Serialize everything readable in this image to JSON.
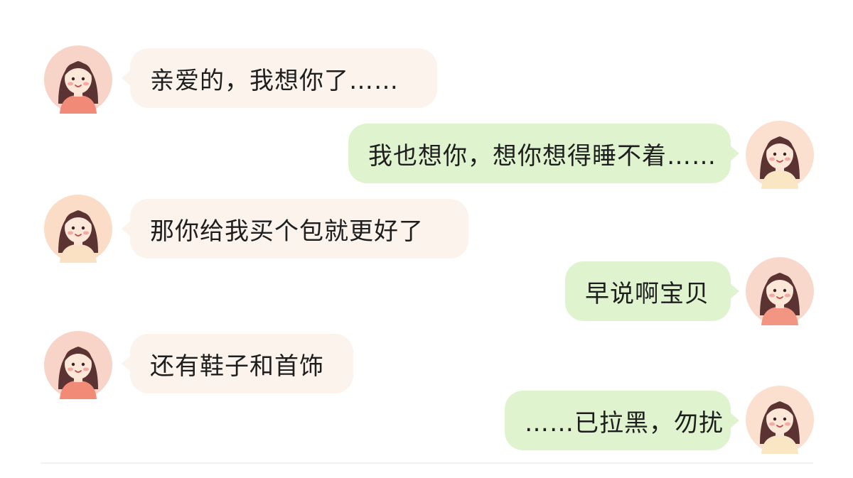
{
  "messages": [
    {
      "side": "in",
      "text": "亲爱的，我想你了……",
      "avatar_bg": "#f7d3c8",
      "shirt": "#f28a78"
    },
    {
      "side": "out",
      "text": "我也想你，想你想得睡不着……",
      "avatar_bg": "#fbe0cf",
      "shirt": "#fbe6c4"
    },
    {
      "side": "in",
      "text": "那你给我买个包就更好了",
      "avatar_bg": "#fbdcc6",
      "shirt": "#fbe1c4"
    },
    {
      "side": "out",
      "text": "早说啊宝贝",
      "avatar_bg": "#f9d8cc",
      "shirt": "#f39583"
    },
    {
      "side": "in",
      "text": "还有鞋子和首饰",
      "avatar_bg": "#f7d3c8",
      "shirt": "#f28a78"
    },
    {
      "side": "out",
      "text": "……已拉黑，勿扰",
      "avatar_bg": "#fbe0cf",
      "shirt": "#fbe6c4"
    }
  ],
  "colors": {
    "incoming_bubble": "#fbf3ec",
    "outgoing_bubble": "#dff3cf",
    "hair": "#5a3332"
  }
}
